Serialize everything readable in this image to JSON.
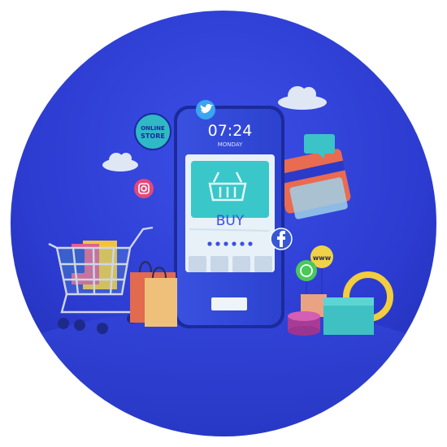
{
  "phone": {
    "time": "07:24",
    "day": "MONDAY",
    "buy_label": "BUY"
  },
  "badges": {
    "online_store_line1": "ONLINE",
    "online_store_line2": "STORE",
    "www": "www"
  },
  "icons": [
    "twitter-icon",
    "instagram-icon",
    "facebook-icon",
    "whatsapp-icon",
    "shopping-basket-icon",
    "chat-bubble-icon"
  ],
  "colors": {
    "background": "#2f3fd6",
    "phone_screen": "#e8f1f8",
    "accent_cyan": "#39c7c9",
    "ring_yellow": "#f2cd3c"
  }
}
